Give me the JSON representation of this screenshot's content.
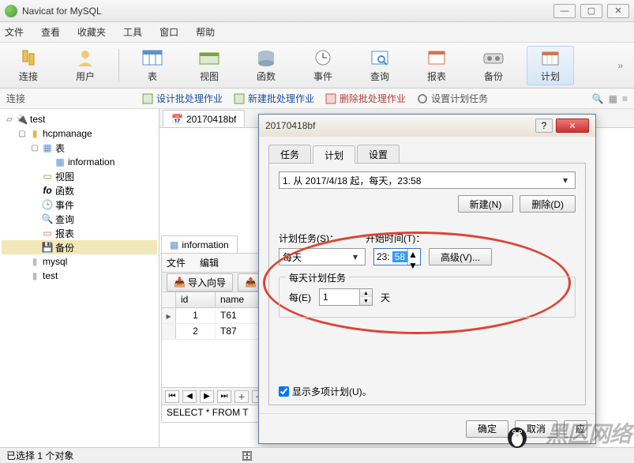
{
  "app": {
    "title": "Navicat for MySQL"
  },
  "menu": {
    "file": "文件",
    "view": "查看",
    "fav": "收藏夹",
    "tools": "工具",
    "window": "窗口",
    "help": "帮助"
  },
  "toolbar": {
    "connect": "连接",
    "user": "用户",
    "table": "表",
    "view": "视图",
    "function": "函数",
    "event": "事件",
    "query": "查询",
    "report": "报表",
    "backup": "备份",
    "schedule": "计划"
  },
  "toolbar2": {
    "conn_label": "连接",
    "design": "设计批处理作业",
    "new": "新建批处理作业",
    "delete": "删除批处理作业",
    "set": "设置计划任务"
  },
  "tree": {
    "root": "test",
    "db": "hcpmanage",
    "tables": "表",
    "table_info": "information",
    "views": "视图",
    "functions": "函数",
    "events": "事件",
    "queries": "查询",
    "reports": "报表",
    "backups": "备份",
    "mysql": "mysql",
    "test2": "test"
  },
  "doc_tab": "20170418bf",
  "inner": {
    "tab": "information",
    "menu_file": "文件",
    "menu_edit": "编辑",
    "import": "导入向导",
    "export": "导",
    "col_id": "id",
    "col_name": "name",
    "rows": [
      {
        "id": "1",
        "name": "T61"
      },
      {
        "id": "2",
        "name": "T87"
      }
    ],
    "sql": "SELECT * FROM T"
  },
  "dialog": {
    "title": "20170418bf",
    "tab_task": "任务",
    "tab_sched": "计划",
    "tab_settings": "设置",
    "schedule_line": "1. 从 2017/4/18 起，每天，23:58",
    "btn_new": "新建(N)",
    "btn_del": "删除(D)",
    "lbl_sched_task": "计划任务(S)：",
    "lbl_start_time": "开始时间(T)：",
    "freq_value": "每天",
    "time_hh": "23:",
    "time_mm": "58",
    "btn_adv": "高级(V)...",
    "group_title": "每天计划任务",
    "lbl_every": "每(E)",
    "every_value": "1",
    "lbl_days": "天",
    "chk_multi": "显示多项计划(U)。",
    "btn_ok": "确定",
    "btn_cancel": "取消",
    "btn_apply": "应"
  },
  "status": {
    "selected": "已选择 1 个对象"
  },
  "watermark": "黑区网络"
}
